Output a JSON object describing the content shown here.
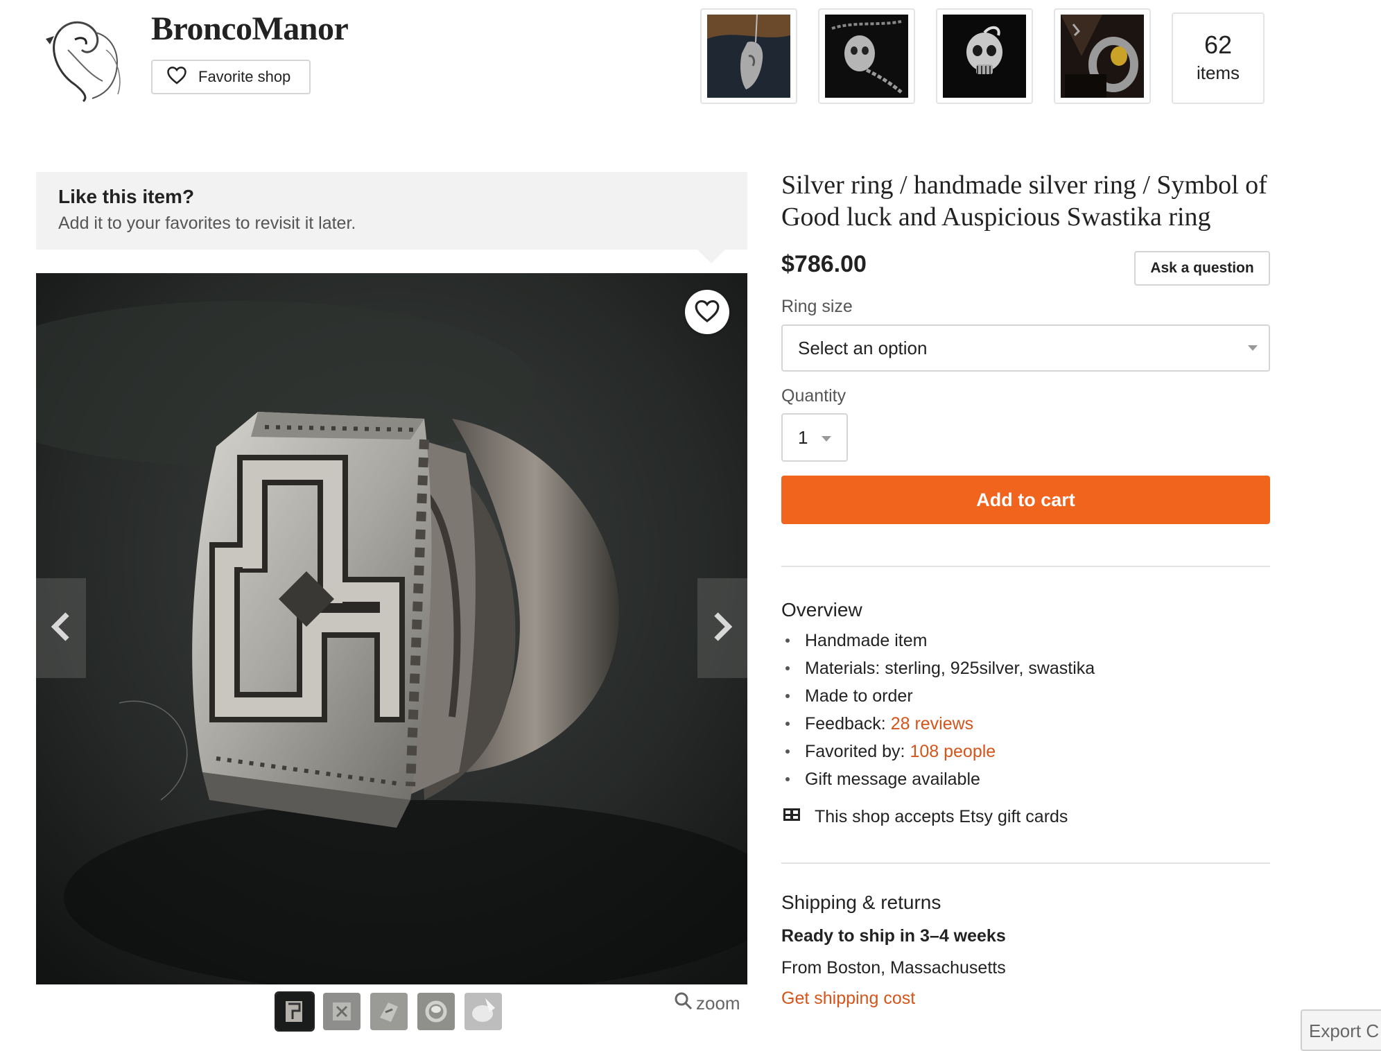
{
  "shop": {
    "name": "BroncoManor",
    "favorite_label": "Favorite shop",
    "item_count": "62",
    "item_count_label": "items",
    "featured_thumbnails": [
      "pendant-photo",
      "skull-chain-photo",
      "skull-pendant-photo",
      "gold-ring-photo"
    ]
  },
  "favorite_banner": {
    "title": "Like this item?",
    "subtitle": "Add it to your favorites to revisit it later."
  },
  "gallery": {
    "image_icon": "ring-photo",
    "thumbnail_count": 5,
    "zoom_label": "zoom"
  },
  "listing": {
    "title": "Silver ring / handmade silver ring / Symbol of Good luck and Auspicious Swastika ring",
    "price": "$786.00",
    "ask_label": "Ask a question",
    "ring_size_label": "Ring size",
    "ring_size_value": "Select an option",
    "quantity_label": "Quantity",
    "quantity_value": "1",
    "add_to_cart_label": "Add to cart"
  },
  "overview": {
    "heading": "Overview",
    "items": [
      {
        "text": "Handmade item"
      },
      {
        "text": "Materials: sterling, 925silver, swastika"
      },
      {
        "text": "Made to order"
      },
      {
        "text": "Feedback: ",
        "link": "28 reviews"
      },
      {
        "text": "Favorited by: ",
        "link": "108 people"
      },
      {
        "text": "Gift message available"
      }
    ],
    "gift_cards": "This shop accepts Etsy gift cards"
  },
  "shipping": {
    "heading": "Shipping & returns",
    "ready": "Ready to ship in 3–4 weeks",
    "from": "From Boston, Massachusetts",
    "cost_link": "Get shipping cost"
  },
  "export_button": "Export C",
  "colors": {
    "accent": "#f1641e",
    "link": "#d5541a",
    "banner_bg": "#f2f2f2"
  }
}
